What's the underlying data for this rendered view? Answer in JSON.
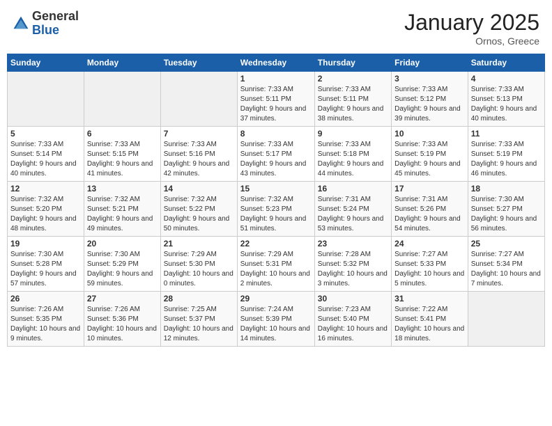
{
  "header": {
    "logo_general": "General",
    "logo_blue": "Blue",
    "month_title": "January 2025",
    "location": "Ornos, Greece"
  },
  "weekdays": [
    "Sunday",
    "Monday",
    "Tuesday",
    "Wednesday",
    "Thursday",
    "Friday",
    "Saturday"
  ],
  "weeks": [
    [
      {
        "day": "",
        "details": ""
      },
      {
        "day": "",
        "details": ""
      },
      {
        "day": "",
        "details": ""
      },
      {
        "day": "1",
        "details": "Sunrise: 7:33 AM\nSunset: 5:11 PM\nDaylight: 9 hours and 37 minutes."
      },
      {
        "day": "2",
        "details": "Sunrise: 7:33 AM\nSunset: 5:11 PM\nDaylight: 9 hours and 38 minutes."
      },
      {
        "day": "3",
        "details": "Sunrise: 7:33 AM\nSunset: 5:12 PM\nDaylight: 9 hours and 39 minutes."
      },
      {
        "day": "4",
        "details": "Sunrise: 7:33 AM\nSunset: 5:13 PM\nDaylight: 9 hours and 40 minutes."
      }
    ],
    [
      {
        "day": "5",
        "details": "Sunrise: 7:33 AM\nSunset: 5:14 PM\nDaylight: 9 hours and 40 minutes."
      },
      {
        "day": "6",
        "details": "Sunrise: 7:33 AM\nSunset: 5:15 PM\nDaylight: 9 hours and 41 minutes."
      },
      {
        "day": "7",
        "details": "Sunrise: 7:33 AM\nSunset: 5:16 PM\nDaylight: 9 hours and 42 minutes."
      },
      {
        "day": "8",
        "details": "Sunrise: 7:33 AM\nSunset: 5:17 PM\nDaylight: 9 hours and 43 minutes."
      },
      {
        "day": "9",
        "details": "Sunrise: 7:33 AM\nSunset: 5:18 PM\nDaylight: 9 hours and 44 minutes."
      },
      {
        "day": "10",
        "details": "Sunrise: 7:33 AM\nSunset: 5:19 PM\nDaylight: 9 hours and 45 minutes."
      },
      {
        "day": "11",
        "details": "Sunrise: 7:33 AM\nSunset: 5:19 PM\nDaylight: 9 hours and 46 minutes."
      }
    ],
    [
      {
        "day": "12",
        "details": "Sunrise: 7:32 AM\nSunset: 5:20 PM\nDaylight: 9 hours and 48 minutes."
      },
      {
        "day": "13",
        "details": "Sunrise: 7:32 AM\nSunset: 5:21 PM\nDaylight: 9 hours and 49 minutes."
      },
      {
        "day": "14",
        "details": "Sunrise: 7:32 AM\nSunset: 5:22 PM\nDaylight: 9 hours and 50 minutes."
      },
      {
        "day": "15",
        "details": "Sunrise: 7:32 AM\nSunset: 5:23 PM\nDaylight: 9 hours and 51 minutes."
      },
      {
        "day": "16",
        "details": "Sunrise: 7:31 AM\nSunset: 5:24 PM\nDaylight: 9 hours and 53 minutes."
      },
      {
        "day": "17",
        "details": "Sunrise: 7:31 AM\nSunset: 5:26 PM\nDaylight: 9 hours and 54 minutes."
      },
      {
        "day": "18",
        "details": "Sunrise: 7:30 AM\nSunset: 5:27 PM\nDaylight: 9 hours and 56 minutes."
      }
    ],
    [
      {
        "day": "19",
        "details": "Sunrise: 7:30 AM\nSunset: 5:28 PM\nDaylight: 9 hours and 57 minutes."
      },
      {
        "day": "20",
        "details": "Sunrise: 7:30 AM\nSunset: 5:29 PM\nDaylight: 9 hours and 59 minutes."
      },
      {
        "day": "21",
        "details": "Sunrise: 7:29 AM\nSunset: 5:30 PM\nDaylight: 10 hours and 0 minutes."
      },
      {
        "day": "22",
        "details": "Sunrise: 7:29 AM\nSunset: 5:31 PM\nDaylight: 10 hours and 2 minutes."
      },
      {
        "day": "23",
        "details": "Sunrise: 7:28 AM\nSunset: 5:32 PM\nDaylight: 10 hours and 3 minutes."
      },
      {
        "day": "24",
        "details": "Sunrise: 7:27 AM\nSunset: 5:33 PM\nDaylight: 10 hours and 5 minutes."
      },
      {
        "day": "25",
        "details": "Sunrise: 7:27 AM\nSunset: 5:34 PM\nDaylight: 10 hours and 7 minutes."
      }
    ],
    [
      {
        "day": "26",
        "details": "Sunrise: 7:26 AM\nSunset: 5:35 PM\nDaylight: 10 hours and 9 minutes."
      },
      {
        "day": "27",
        "details": "Sunrise: 7:26 AM\nSunset: 5:36 PM\nDaylight: 10 hours and 10 minutes."
      },
      {
        "day": "28",
        "details": "Sunrise: 7:25 AM\nSunset: 5:37 PM\nDaylight: 10 hours and 12 minutes."
      },
      {
        "day": "29",
        "details": "Sunrise: 7:24 AM\nSunset: 5:39 PM\nDaylight: 10 hours and 14 minutes."
      },
      {
        "day": "30",
        "details": "Sunrise: 7:23 AM\nSunset: 5:40 PM\nDaylight: 10 hours and 16 minutes."
      },
      {
        "day": "31",
        "details": "Sunrise: 7:22 AM\nSunset: 5:41 PM\nDaylight: 10 hours and 18 minutes."
      },
      {
        "day": "",
        "details": ""
      }
    ]
  ]
}
